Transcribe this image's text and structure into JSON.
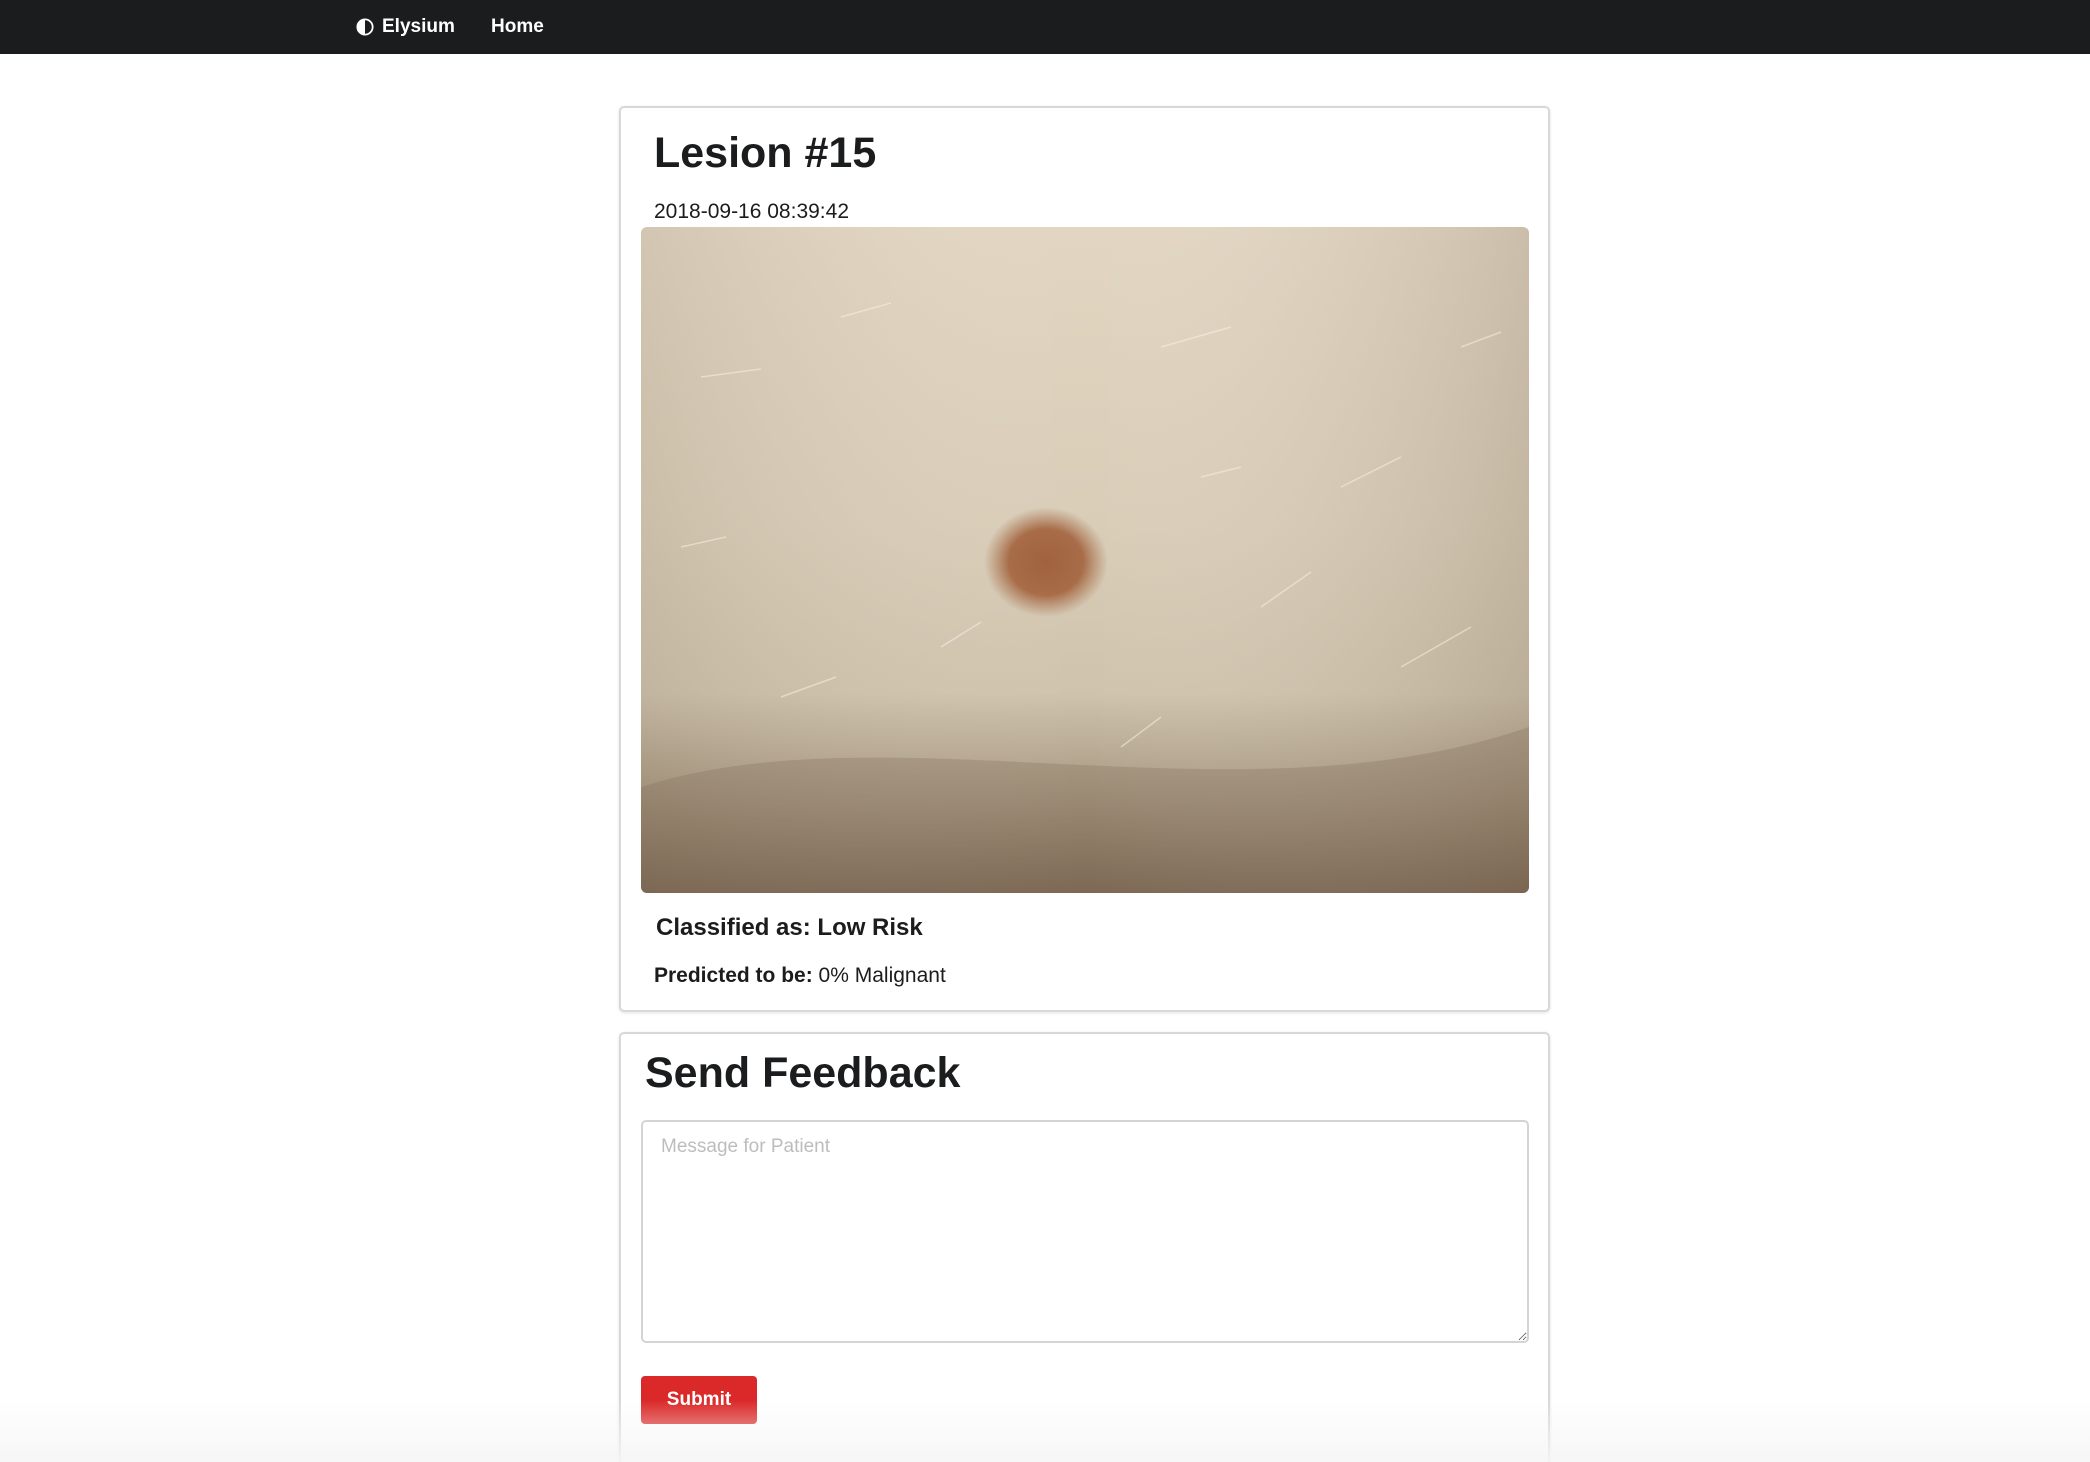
{
  "nav": {
    "brand_label": "Elysium",
    "brand_icon": "half-circle-icon",
    "home_label": "Home"
  },
  "lesion": {
    "title": "Lesion #15",
    "timestamp": "2018-09-16 08:39:42",
    "classified_label": "Classified as: Low Risk",
    "predicted_label": "Predicted to be:",
    "predicted_value": "0% Malignant"
  },
  "feedback": {
    "title": "Send Feedback",
    "placeholder": "Message for Patient",
    "submit_label": "Submit"
  },
  "colors": {
    "navbar": "#1b1c1d",
    "submit": "#db2828",
    "card_border": "#d8d8d9"
  }
}
